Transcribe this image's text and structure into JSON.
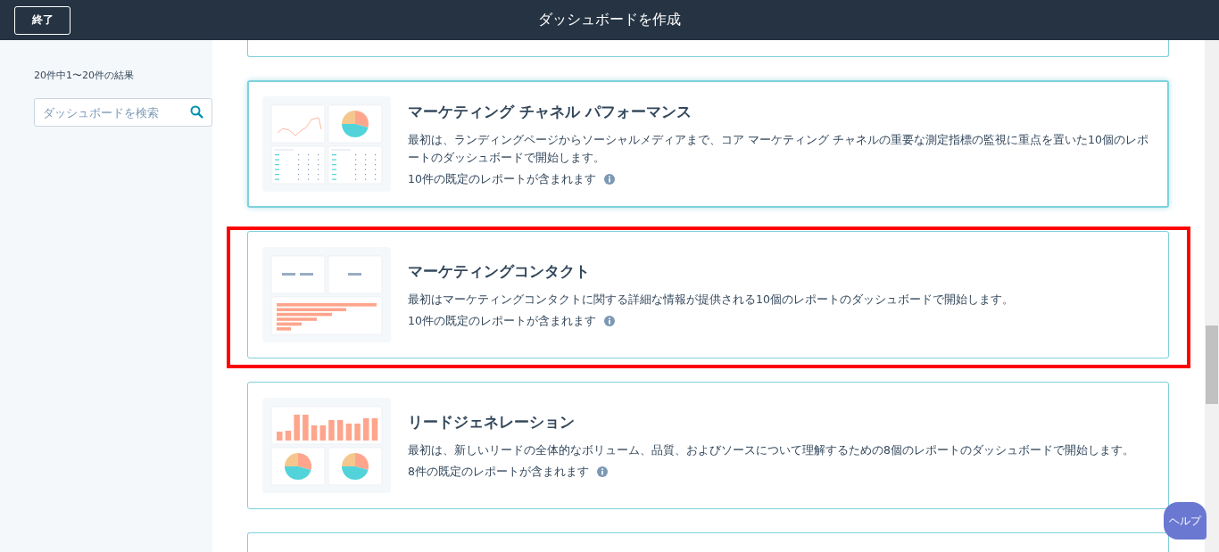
{
  "header": {
    "exit_button": "終了",
    "title": "ダッシュボードを作成"
  },
  "sidebar": {
    "result_count": "20件中1〜20件の結果",
    "search": {
      "placeholder": "ダッシュボードを検索"
    }
  },
  "cards": [
    {
      "title": "マーケティング チャネル パフォーマンス",
      "description": "最初は、ランディングページからソーシャルメディアまで、コア マーケティング チャネルの重要な測定指標の監視に重点を置いた10個のレポートのダッシュボードで開始します。",
      "reports": "10件の既定のレポートが含まれます",
      "kind": "line-pie-tables",
      "selected": true,
      "highlighted": false
    },
    {
      "title": "マーケティングコンタクト",
      "description": "最初はマーケティングコンタクトに関する詳細な情報が提供される10個のレポートのダッシュボードで開始します。",
      "reports": "10件の既定のレポートが含まれます",
      "kind": "kpis-bars",
      "selected": false,
      "highlighted": true
    },
    {
      "title": "リードジェネレーション",
      "description": "最初は、新しいリードの全体的なボリューム、品質、およびソースについて理解するための8個のレポートのダッシュボードで開始します。",
      "reports": "8件の既定のレポートが含まれます",
      "kind": "bars-pies",
      "selected": false,
      "highlighted": false
    }
  ],
  "help_button": "ヘルプ"
}
